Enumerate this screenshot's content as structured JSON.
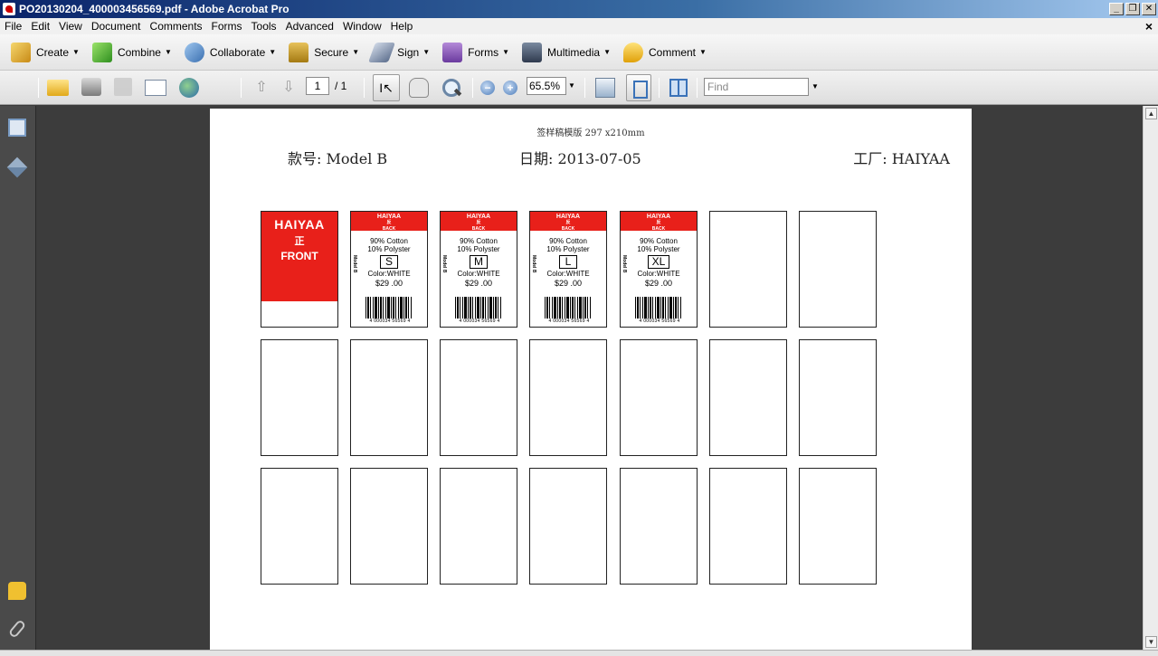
{
  "window": {
    "title": "PO20130204_400003456569.pdf - Adobe Acrobat Pro"
  },
  "menu": [
    "File",
    "Edit",
    "View",
    "Document",
    "Comments",
    "Forms",
    "Tools",
    "Advanced",
    "Window",
    "Help"
  ],
  "tasks": [
    {
      "label": "Create",
      "icon": "create-icon"
    },
    {
      "label": "Combine",
      "icon": "combine-icon"
    },
    {
      "label": "Collaborate",
      "icon": "collaborate-icon"
    },
    {
      "label": "Secure",
      "icon": "lock-icon"
    },
    {
      "label": "Sign",
      "icon": "pen-icon"
    },
    {
      "label": "Forms",
      "icon": "form-icon"
    },
    {
      "label": "Multimedia",
      "icon": "multimedia-icon"
    },
    {
      "label": "Comment",
      "icon": "comment-icon"
    }
  ],
  "nav": {
    "page_current": "1",
    "page_total": "/ 1",
    "zoom": "65.5%",
    "find_placeholder": "Find"
  },
  "document": {
    "page_title": "签样稿模版 297 x210mm",
    "style_no": "款号: Model B",
    "date": "日期: 2013-07-05",
    "factory": "工厂: HAIYAA"
  },
  "front_tag": {
    "brand": "HAIYAA",
    "cn": "正",
    "en": "FRONT",
    "color": "#e8201a"
  },
  "back_tags": [
    {
      "brand": "HAIYAA",
      "cn": "反",
      "en": "BACK",
      "fabric1": "90% Cotton",
      "fabric2": "10% Polyster",
      "size": "S",
      "color": "Color:WHITE",
      "price": "$29 .00",
      "model": "Model B",
      "barcode": "4 000034 56569 4"
    },
    {
      "brand": "HAIYAA",
      "cn": "反",
      "en": "BACK",
      "fabric1": "90% Cotton",
      "fabric2": "10% Polyster",
      "size": "M",
      "color": "Color:WHITE",
      "price": "$29 .00",
      "model": "Model B",
      "barcode": "4 000034 56569 4"
    },
    {
      "brand": "HAIYAA",
      "cn": "反",
      "en": "BACK",
      "fabric1": "90% Cotton",
      "fabric2": "10% Polyster",
      "size": "L",
      "color": "Color:WHITE",
      "price": "$29 .00",
      "model": "Model B",
      "barcode": "4 000034 56569 4"
    },
    {
      "brand": "HAIYAA",
      "cn": "反",
      "en": "BACK",
      "fabric1": "90% Cotton",
      "fabric2": "10% Polyster",
      "size": "XL",
      "color": "Color:WHITE",
      "price": "$29 .00",
      "model": "Model B",
      "barcode": "4 000034 56569 4"
    }
  ]
}
